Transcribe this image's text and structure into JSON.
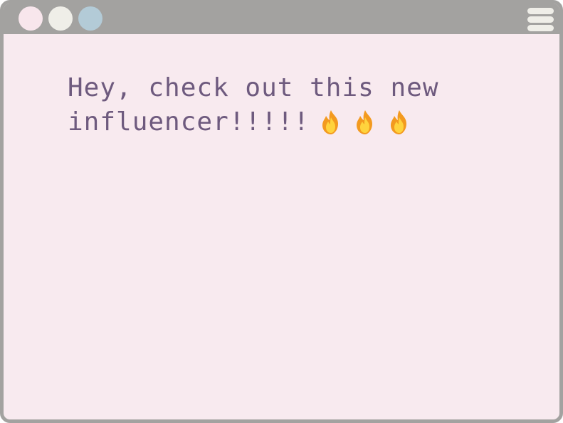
{
  "window": {
    "controls": [
      "close",
      "minimize",
      "maximize"
    ],
    "menu_icon": "hamburger-menu-icon",
    "colors": {
      "frame": "#a3a2a0",
      "background": "#f8eaef",
      "text": "#6e5a7e",
      "dot_1": "#f8e6ec",
      "dot_2": "#efeee8",
      "dot_3": "#b3cbd7"
    }
  },
  "message": {
    "line_1": "Hey, check out this new",
    "line_2": "influencer!!!!!",
    "emojis": [
      "fire-icon",
      "fire-icon",
      "fire-icon"
    ]
  }
}
